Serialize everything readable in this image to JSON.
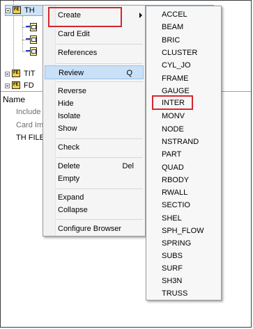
{
  "tree": {
    "top_item_label": "TH",
    "items": [
      {
        "label": "TIT",
        "icon": "folder-icon"
      },
      {
        "label": "FD",
        "icon": "folder-icon"
      }
    ]
  },
  "properties": {
    "header": "Name",
    "rows": [
      "Include",
      "Card Im",
      "TH FILE"
    ]
  },
  "context_menu": {
    "groups": [
      [
        {
          "label": "Create",
          "submenu": true,
          "highlighted_box": true
        },
        {
          "label": "Card Edit"
        }
      ],
      [
        {
          "label": "References"
        }
      ],
      [
        {
          "label": "Review",
          "shortcut": "Q",
          "hover": true
        }
      ],
      [
        {
          "label": "Reverse"
        },
        {
          "label": "Hide"
        },
        {
          "label": "Isolate"
        },
        {
          "label": "Show"
        }
      ],
      [
        {
          "label": "Check"
        }
      ],
      [
        {
          "label": "Delete",
          "shortcut": "Del"
        },
        {
          "label": "Empty"
        }
      ],
      [
        {
          "label": "Expand"
        },
        {
          "label": "Collapse"
        }
      ],
      [
        {
          "label": "Configure Browser"
        }
      ]
    ]
  },
  "create_submenu": {
    "items": [
      "ACCEL",
      "BEAM",
      "BRIC",
      "CLUSTER",
      "CYL_JO",
      "FRAME",
      "GAUGE",
      "INTER",
      "MONV",
      "NODE",
      "NSTRAND",
      "PART",
      "QUAD",
      "RBODY",
      "RWALL",
      "SECTIO",
      "SHEL",
      "SPH_FLOW",
      "SPRING",
      "SUBS",
      "SURF",
      "SH3N",
      "TRUSS"
    ],
    "boxed_item": "INTER"
  },
  "colors": {
    "highlight_box": "#d6262e",
    "hover_row": "#c9e0f7",
    "selected_tree_row": "#cde3f7"
  }
}
